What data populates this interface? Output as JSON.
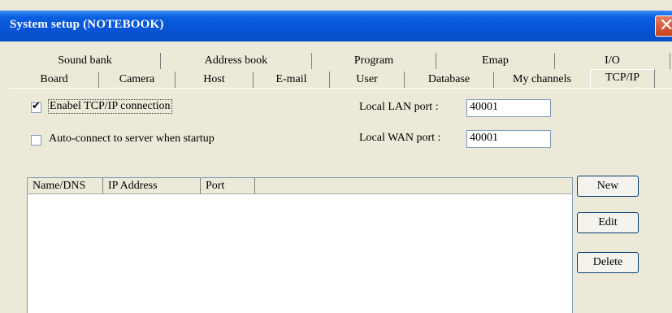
{
  "window": {
    "title": "System setup (NOTEBOOK)"
  },
  "tabs_row1": [
    "Sound bank",
    "Address book",
    "Program",
    "Emap",
    "I/O"
  ],
  "tabs_row2": [
    "Board",
    "Camera",
    "Host",
    "E-mail",
    "User",
    "Database",
    "My channels",
    "TCP/IP"
  ],
  "active_tab": "TCP/IP",
  "tcpip": {
    "enable_label": "Enabel TCP/IP connection",
    "enable_checked": true,
    "autoconnect_label": "Auto-connect to server when startup",
    "autoconnect_checked": false,
    "lan_port_label": "Local LAN port :",
    "lan_port_value": "40001",
    "wan_port_label": "Local WAN port :",
    "wan_port_value": "40001"
  },
  "server_list": {
    "columns": [
      "Name/DNS",
      "IP Address",
      "Port"
    ],
    "rows": []
  },
  "buttons": {
    "new": "New",
    "edit": "Edit",
    "delete": "Delete"
  },
  "colors": {
    "titlebar": "#0a5ee0",
    "dialog_bg": "#ece9d8",
    "close_btn": "#c8421c"
  }
}
